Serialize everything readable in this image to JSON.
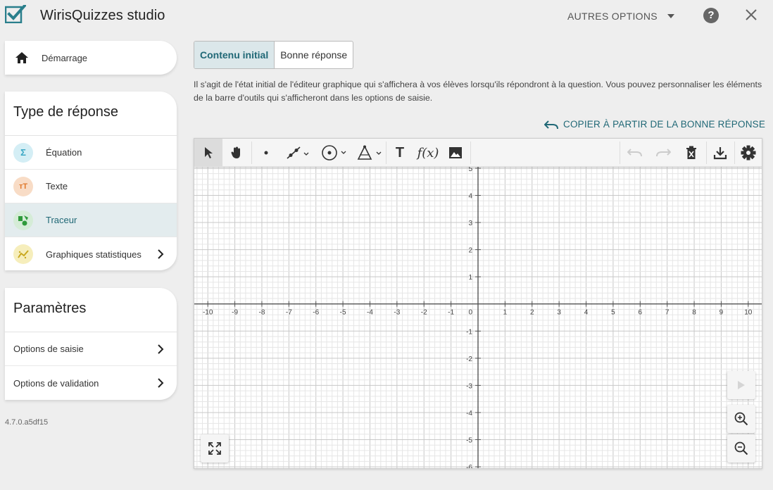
{
  "header": {
    "title": "WirisQuizzes studio",
    "more_options": "AUTRES OPTIONS",
    "help": "?"
  },
  "sidebar": {
    "home_label": "Démarrage",
    "type_section": {
      "title": "Type de réponse",
      "items": [
        {
          "label": "Équation",
          "icon": "sigma-icon",
          "color": "#3aa7c4"
        },
        {
          "label": "Texte",
          "icon": "text-size-icon",
          "color": "#e07a2e"
        },
        {
          "label": "Traceur",
          "icon": "shapes-icon",
          "color": "#2f9a3a",
          "active": true
        },
        {
          "label": "Graphiques statistiques",
          "icon": "stats-chart-icon",
          "color": "#c9a820"
        }
      ]
    },
    "params_section": {
      "title": "Paramètres",
      "items": [
        {
          "label": "Options de saisie"
        },
        {
          "label": "Options de validation"
        }
      ]
    },
    "version": "4.7.0.a5df15"
  },
  "main": {
    "tabs": [
      {
        "label": "Contenu initial",
        "active": true
      },
      {
        "label": "Bonne réponse",
        "active": false
      }
    ],
    "description": "Il s'agit de l'état initial de l'éditeur graphique qui s'affichera à vos élèves lorsqu'ils répondront à la question. Vous pouvez personnaliser les éléments de la barre d'outils qui s'afficheront dans les options de saisie.",
    "copy_from_correct": "COPIER À PARTIR DE LA BONNE RÉPONSE"
  },
  "graph": {
    "xlim": [
      -10.5,
      10.5
    ],
    "ylim": [
      -6.05,
      5.05
    ],
    "x_ticks": [
      -10,
      -9,
      -8,
      -7,
      -6,
      -5,
      -4,
      -3,
      -2,
      -1,
      1,
      2,
      3,
      4,
      5,
      6,
      7,
      8,
      9,
      10
    ],
    "y_ticks": [
      -6,
      -5,
      -4,
      -3,
      -2,
      -1,
      1,
      2,
      3,
      4,
      5
    ],
    "origin_label": "0",
    "minor_divisions": 4,
    "grid": true,
    "tools": [
      "select-arrow-icon",
      "pan-hand-icon",
      "point-icon",
      "line-icon",
      "circle-icon",
      "polygon-icon",
      "text-tool-icon",
      "function-icon",
      "image-icon"
    ],
    "function_label": "f(x)",
    "text_tool_label": "T",
    "actions": [
      "undo-icon",
      "redo-icon",
      "delete-all-icon",
      "download-icon",
      "settings-icon"
    ],
    "colors": {
      "axis": "#555555",
      "minor_grid": "#e6e6e6",
      "major_grid": "#c8c8c8",
      "accent": "#206876"
    }
  }
}
